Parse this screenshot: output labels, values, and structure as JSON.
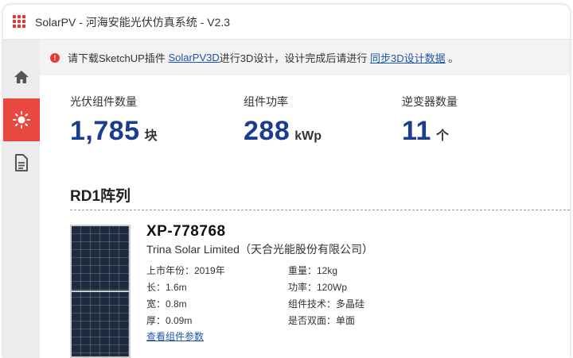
{
  "window": {
    "title": "SolarPV - 河海安能光伏仿真系统 - V2.3"
  },
  "sidebar": {
    "items": [
      {
        "icon": "home-icon"
      },
      {
        "icon": "sun-icon",
        "active": true
      },
      {
        "icon": "document-icon"
      }
    ],
    "active_color": "#e8483f"
  },
  "notice": {
    "text_1": "请下载SketchUP插件",
    "link_1": "SolarPV3D",
    "text_2": "进行3D设计，设计完成后请进行",
    "link_2": "同步3D设计数据",
    "text_3": "。",
    "icon": "alert-icon"
  },
  "stats": [
    {
      "label": "光伏组件数量",
      "value": "1,785",
      "unit": "块"
    },
    {
      "label": "组件功率",
      "value": "288",
      "unit": "kWp"
    },
    {
      "label": "逆变器数量",
      "value": "11",
      "unit": "个"
    }
  ],
  "section": {
    "title": "RD1阵列"
  },
  "module": {
    "model": "XP-778768",
    "manufacturer": "Trina Solar Limited（天合光能股份有限公司）",
    "specs_left": [
      "上市年份：2019年",
      "长：1.6m",
      "宽：0.8m",
      "厚：0.09m"
    ],
    "specs_right": [
      "重量：12kg",
      "功率：120Wp",
      "组件技术：多晶硅",
      "是否双面：单面"
    ],
    "link": "查看组件参数"
  },
  "colors": {
    "accent": "#1a3d8f",
    "link": "#1e56a8",
    "brand": "#e53935"
  }
}
